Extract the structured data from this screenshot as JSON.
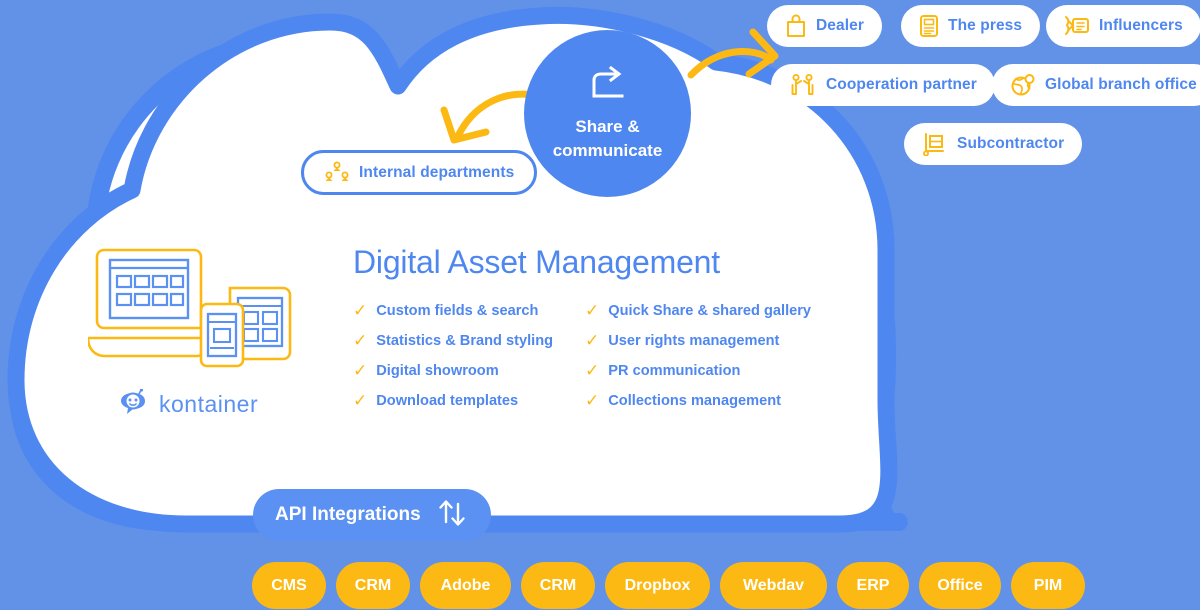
{
  "colors": {
    "background": "#6291e8",
    "cloud_stroke": "#4f87f0",
    "cloud_fill": "#ffffff",
    "accent_blue": "#4f87f0",
    "accent_yellow": "#fdb913",
    "text_white": "#ffffff"
  },
  "center": {
    "title": "Digital Asset Management",
    "brand": "kontainer",
    "features_left": [
      "Custom fields & search",
      "Statistics & Brand styling",
      "Digital showroom",
      "Download templates"
    ],
    "features_right": [
      "Quick Share & shared gallery",
      "User rights management",
      "PR communication",
      "Collections management"
    ],
    "check_glyph": "✓"
  },
  "share_node": {
    "line1": "Share &",
    "line2": "communicate",
    "icon": "share-arrow-icon"
  },
  "internal": {
    "label": "Internal departments",
    "icon": "org-chart-icon"
  },
  "contacts": [
    {
      "label": "Dealer",
      "icon": "shopping-bag-icon"
    },
    {
      "label": "The press",
      "icon": "newspaper-icon"
    },
    {
      "label": "Influencers",
      "icon": "megaphone-speech-icon"
    },
    {
      "label": "Cooperation partner",
      "icon": "two-people-icon"
    },
    {
      "label": "Global branch office",
      "icon": "globe-pin-icon"
    },
    {
      "label": "Subcontractor",
      "icon": "hand-truck-icon"
    }
  ],
  "api": {
    "label": "API Integrations",
    "icon": "up-down-arrows-icon"
  },
  "integrations": [
    {
      "label": "CMS"
    },
    {
      "label": "CRM"
    },
    {
      "label": "Adobe"
    },
    {
      "label": "CRM"
    },
    {
      "label": "Dropbox"
    },
    {
      "label": "Webdav"
    },
    {
      "label": "ERP"
    },
    {
      "label": "Office"
    },
    {
      "label": "PIM"
    }
  ],
  "arrows": {
    "to_internal": "curved-arrow-down-left",
    "to_contacts": "curved-arrow-right"
  }
}
